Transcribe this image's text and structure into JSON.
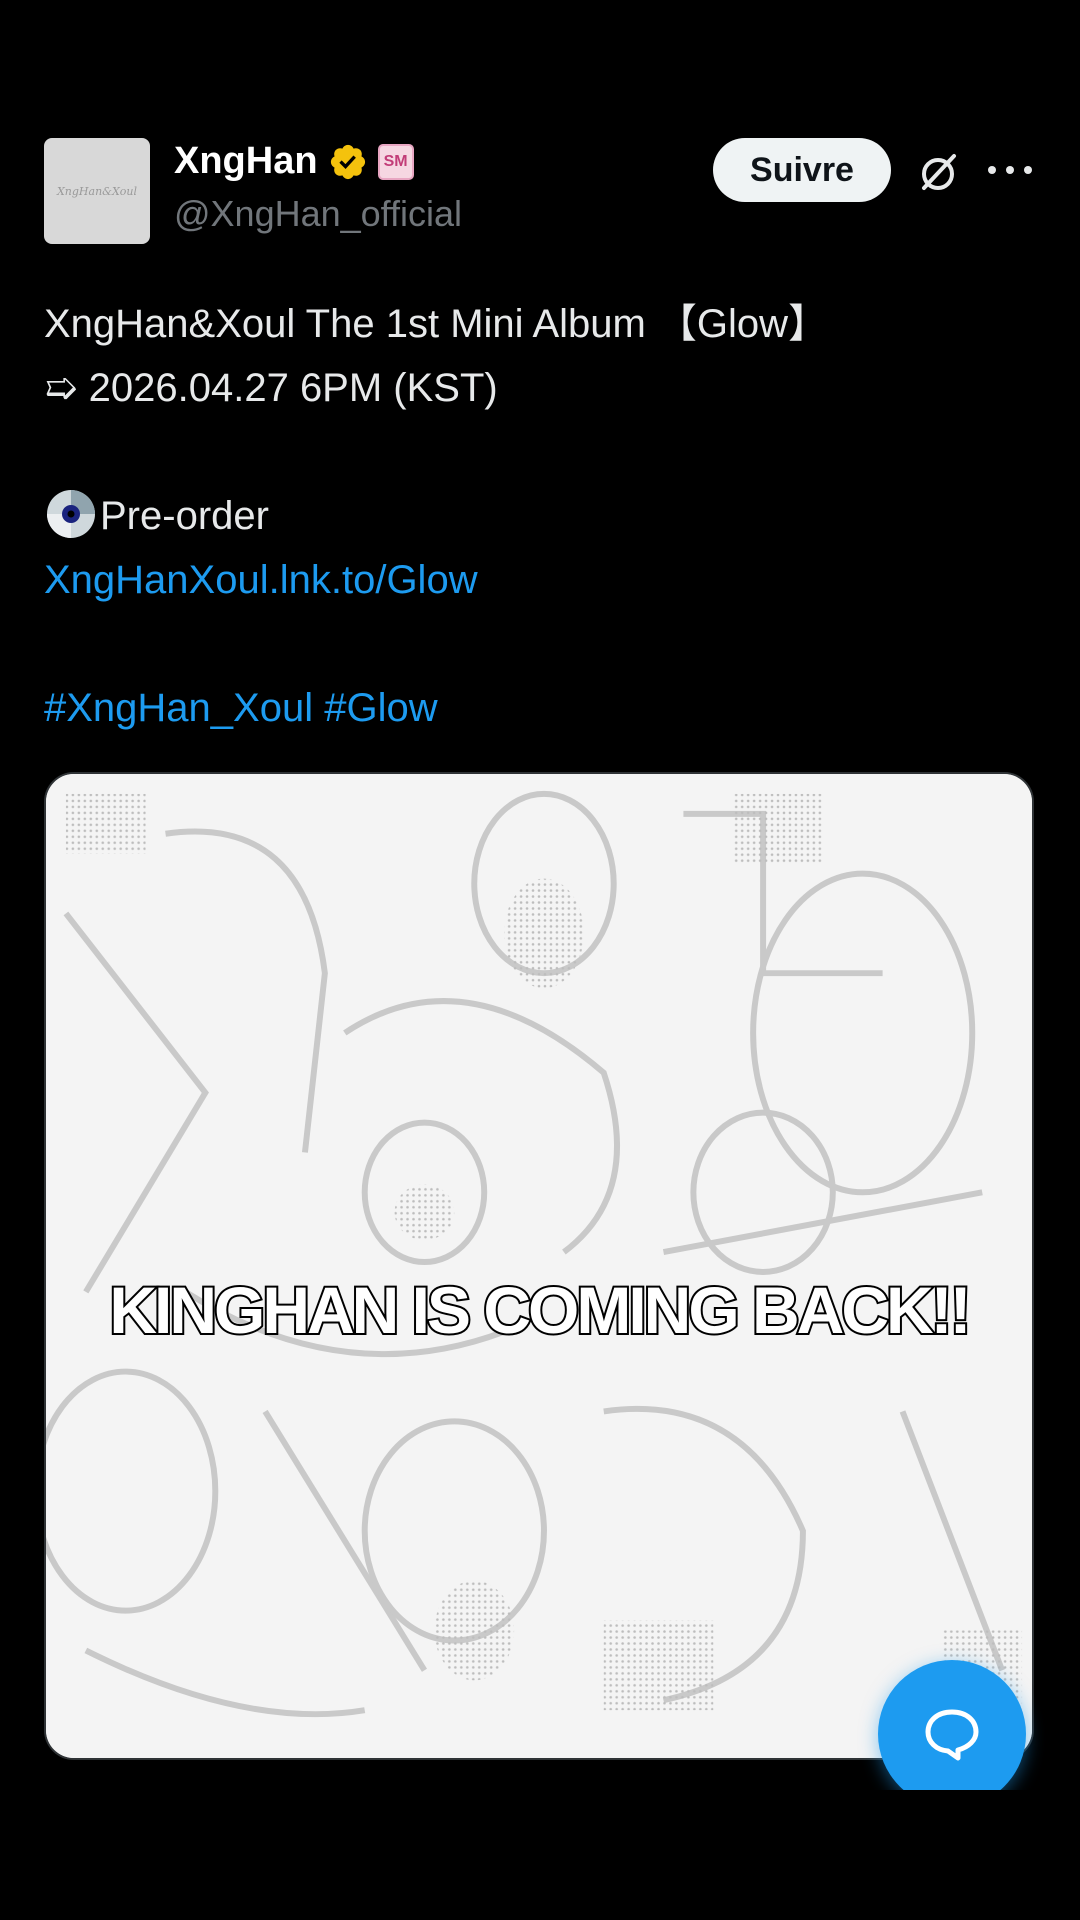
{
  "author": {
    "avatar_text": "XngHan&Xoul",
    "name": "XngHan",
    "affiliation_badge": "SM",
    "handle": "@XngHan_official",
    "verified_color": "#f4c20d"
  },
  "actions": {
    "follow_label": "Suivre",
    "grok_icon": "grok-icon",
    "more_icon": "more-options-icon"
  },
  "post": {
    "line1": "XngHan&Xoul The 1st Mini Album 【Glow】",
    "line2": "➯ 2026.04.27 6PM (KST)",
    "preorder_label": "Pre-order",
    "preorder_link": "XngHanXoul.lnk.to/Glow",
    "hashtag1": "#XngHan_Xoul",
    "hashtag2": "#Glow"
  },
  "media": {
    "caption": "KINGHAN IS COMING BACK!!"
  },
  "fab": {
    "icon": "chat-bubble-icon",
    "color": "#1d9bf0"
  },
  "colors": {
    "link": "#1d9bf0",
    "text": "#e7e9ea",
    "secondary": "#71767b"
  }
}
